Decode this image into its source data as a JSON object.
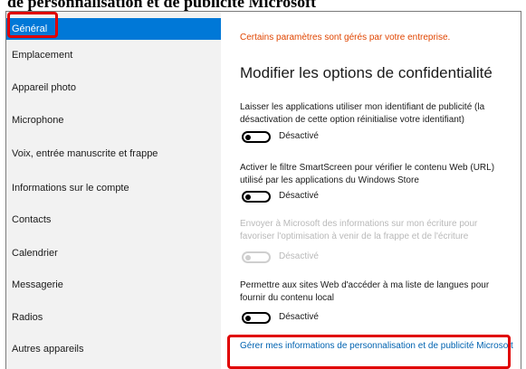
{
  "doc_title": "de personnalisation et de publicité Microsoft",
  "sidebar": {
    "items": [
      {
        "label": "Général",
        "active": true
      },
      {
        "label": "Emplacement"
      },
      {
        "label": "Appareil photo"
      },
      {
        "label": "Microphone"
      },
      {
        "label": "Voix, entrée manuscrite et frappe"
      },
      {
        "label": "Informations sur le compte"
      },
      {
        "label": "Contacts"
      },
      {
        "label": "Calendrier"
      },
      {
        "label": "Messagerie"
      },
      {
        "label": "Radios"
      },
      {
        "label": "Autres appareils"
      }
    ]
  },
  "content": {
    "managed_notice": "Certains paramètres sont gérés par votre entreprise.",
    "section_title": "Modifier les options de confidentialité",
    "options": [
      {
        "text": "Laisser les applications utiliser mon identifiant de publicité (la désactivation de cette option réinitialise votre identifiant)",
        "state": "Désactivé",
        "enabled": true
      },
      {
        "text": "Activer le filtre SmartScreen pour vérifier le contenu Web (URL) utilisé par les applications du Windows Store",
        "state": "Désactivé",
        "enabled": true
      },
      {
        "text": "Envoyer à Microsoft des informations sur mon écriture pour favoriser l'optimisation à venir de la frappe et de l'écriture",
        "state": "Désactivé",
        "enabled": false
      },
      {
        "text": "Permettre aux sites Web d'accéder à ma liste de langues pour fournir du contenu local",
        "state": "Désactivé",
        "enabled": true
      }
    ],
    "manage_link": "Gérer mes informations de personnalisation et de publicité Microsoft"
  },
  "colors": {
    "accent": "#0078d7",
    "highlight_box": "#e00000",
    "managed_notice": "#e04500",
    "link": "#0063b1"
  }
}
